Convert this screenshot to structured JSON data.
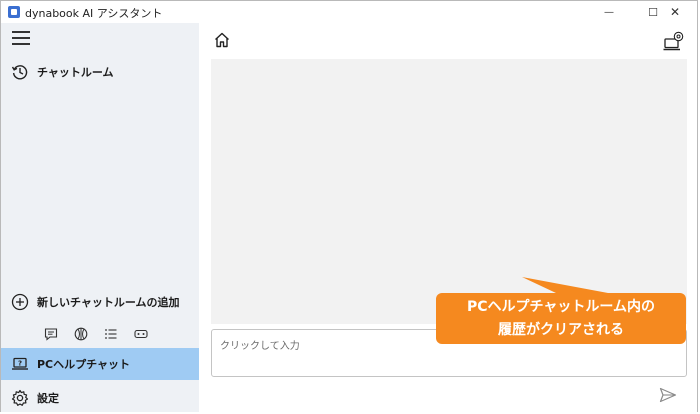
{
  "window": {
    "title": "dynabook AI アシスタント",
    "minimize_symbol": "—",
    "maximize_symbol": "☐",
    "close_symbol": "✕"
  },
  "sidebar": {
    "menu_icon": "hamburger-icon",
    "chat_room": {
      "label": "チャットルーム",
      "icon": "history-icon"
    },
    "add_chat_room": {
      "label": "新しいチャットルームの追加",
      "icon": "plus-circle-icon"
    },
    "mini_icons": [
      "chat-bubble-icon",
      "sports-ball-icon",
      "list-icon",
      "game-controller-icon"
    ],
    "pc_help_chat": {
      "label": "PCヘルプチャット",
      "icon": "laptop-help-icon",
      "selected": true
    },
    "settings": {
      "label": "設定",
      "icon": "gear-icon"
    }
  },
  "main": {
    "home_icon": "home-icon",
    "pc_settings_icon": "laptop-gear-icon",
    "input": {
      "placeholder": "クリックして入力",
      "value": ""
    },
    "send_icon": "send-icon"
  },
  "callout": {
    "line1": "PCヘルプチャットルーム内の",
    "line2": "履歴がクリアされる",
    "color": "#f5891f"
  },
  "colors": {
    "sidebar_bg": "#eef1f5",
    "selected_bg": "#9fcbf3",
    "chat_area_bg": "#f2f2f2"
  }
}
